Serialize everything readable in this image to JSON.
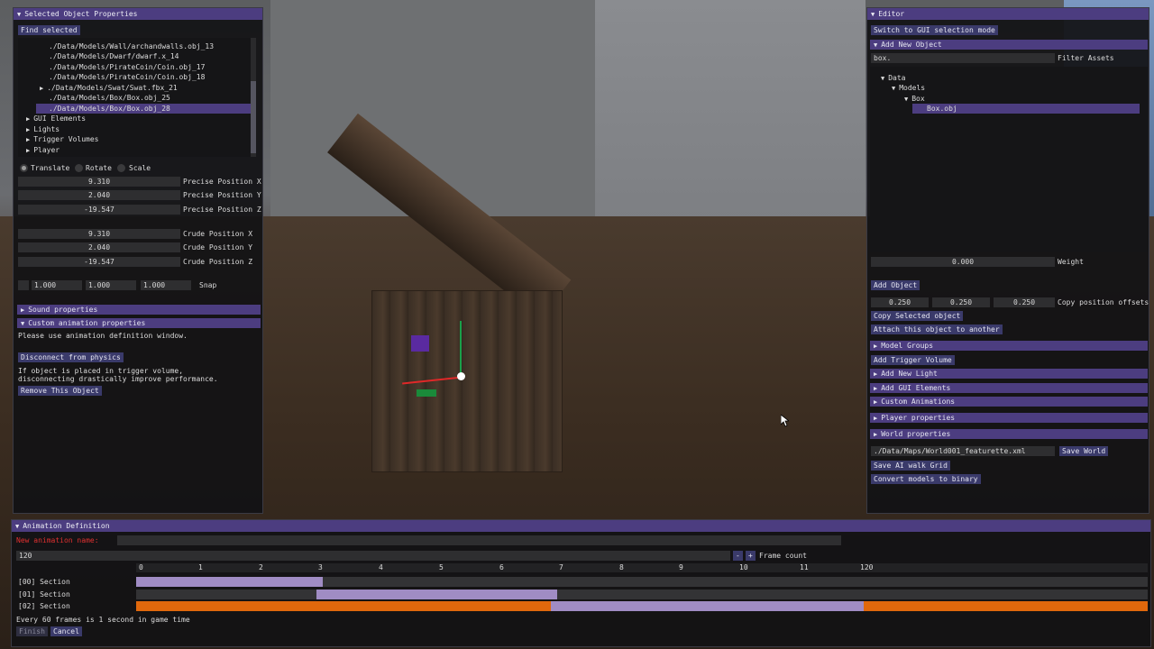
{
  "left_panel": {
    "title": "Selected Object Properties",
    "find_button": "Find selected",
    "tree_items": [
      "./Data/Models/Wall/archandwalls.obj_13",
      "./Data/Models/Dwarf/dwarf.x_14",
      "./Data/Models/PirateCoin/Coin.obj_17",
      "./Data/Models/PirateCoin/Coin.obj_18",
      "./Data/Models/Swat/Swat.fbx_21",
      "./Data/Models/Box/Box.obj_25",
      "./Data/Models/Box/Box.obj_28"
    ],
    "tree_groups": [
      "GUI Elements",
      "Lights",
      "Trigger Volumes",
      "Player"
    ],
    "modes": [
      "Translate",
      "Rotate",
      "Scale"
    ],
    "precise": [
      {
        "value": "9.310",
        "label": "Precise Position X"
      },
      {
        "value": "2.040",
        "label": "Precise Position Y"
      },
      {
        "value": "-19.547",
        "label": "Precise Position Z"
      }
    ],
    "crude": [
      {
        "value": "9.310",
        "label": "Crude Position X"
      },
      {
        "value": "2.040",
        "label": "Crude Position Y"
      },
      {
        "value": "-19.547",
        "label": "Crude Position Z"
      }
    ],
    "snap": {
      "values": [
        "1.000",
        "1.000",
        "1.000"
      ],
      "label": "Snap"
    },
    "sound_header": "Sound properties",
    "anim_header": "Custom animation properties",
    "anim_note": "Please use animation definition window.",
    "disconnect_button": "Disconnect from physics",
    "trigger_note_1": "If object is placed in trigger volume,",
    "trigger_note_2": "disconnecting drastically improve performance.",
    "remove_button": "Remove This Object"
  },
  "right_panel": {
    "title": "Editor",
    "switch_button": "Switch to GUI selection mode",
    "add_new_header": "Add New Object",
    "filter_value": "box.",
    "filter_label": "Filter Assets",
    "asset_tree": [
      "Data",
      "Models",
      "Box",
      "Box.obj"
    ],
    "weight_value": "0.000",
    "weight_label": "Weight",
    "add_object_button": "Add Object",
    "offsets": [
      "0.250",
      "0.250",
      "0.250"
    ],
    "offsets_label": "Copy position offsets",
    "copy_button": "Copy Selected object",
    "attach_button": "Attach this object to another",
    "model_groups": "Model Groups",
    "add_trigger_button": "Add Trigger Volume",
    "add_light": "Add New Light",
    "add_gui": "Add GUI Elements",
    "custom_anims": "Custom Animations",
    "player_props": "Player properties",
    "world_props": "World properties",
    "world_path": "./Data/Maps/World001_featurette.xml",
    "save_world_button": "Save World",
    "save_ai_button": "Save AI walk Grid",
    "convert_button": "Convert models to binary"
  },
  "anim_panel": {
    "title": "Animation Definition",
    "name_label": "New animation name:",
    "frame_count_value": "120",
    "minus": "-",
    "plus": "+",
    "frame_count_label": "Frame count",
    "ticks": [
      "0",
      "1",
      "2",
      "3",
      "4",
      "5",
      "6",
      "7",
      "8",
      "9",
      "10",
      "11",
      "120"
    ],
    "sections": [
      {
        "label": "[00] Section",
        "start": 0,
        "end": 31
      },
      {
        "label": "[01] Section",
        "start": 30,
        "end": 70
      },
      {
        "label": "[02] Section",
        "start": 69,
        "end": 121
      }
    ],
    "note": "Every 60 frames is 1 second in game time",
    "finish_button": "Finish",
    "cancel_button": "Cancel"
  },
  "colors": {
    "accent": "#4c3d80",
    "section": "#a08cc4",
    "orange": "#e0680c"
  }
}
